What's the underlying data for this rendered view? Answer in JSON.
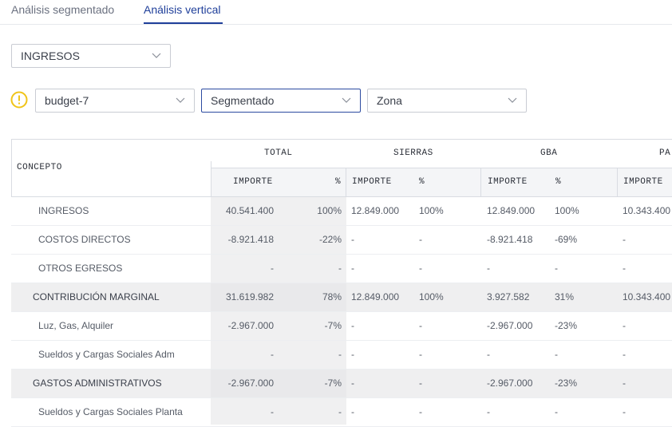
{
  "tabs": [
    {
      "label": "Análisis segmentado",
      "active": false
    },
    {
      "label": "Análisis vertical",
      "active": true
    }
  ],
  "filters": {
    "concept": "INGRESOS",
    "budget": "budget-7",
    "mode": "Segmentado",
    "zone": "Zona"
  },
  "table": {
    "concept_header": "CONCEPTO",
    "groups": [
      "TOTAL",
      "SIERRAS",
      "GBA",
      "PA"
    ],
    "importe": "IMPORTE",
    "pct": "%",
    "rows": [
      {
        "label": "INGRESOS",
        "total": "40.541.400",
        "total_pct": "100%",
        "s": "12.849.000",
        "s_pct": "100%",
        "g": "12.849.000",
        "g_pct": "100%",
        "p": "10.343.400",
        "indent": true,
        "shade": false
      },
      {
        "label": "COSTOS DIRECTOS",
        "total": "-8.921.418",
        "total_pct": "-22%",
        "s": "-",
        "s_pct": "-",
        "g": "-8.921.418",
        "g_pct": "-69%",
        "p": "-",
        "indent": true,
        "shade": false
      },
      {
        "label": "OTROS EGRESOS",
        "total": "-",
        "total_pct": "-",
        "s": "-",
        "s_pct": "-",
        "g": "-",
        "g_pct": "-",
        "p": "-",
        "indent": true,
        "shade": false
      },
      {
        "label": "CONTRIBUCIÓN MARGINAL",
        "total": "31.619.982",
        "total_pct": "78%",
        "s": "12.849.000",
        "s_pct": "100%",
        "g": "3.927.582",
        "g_pct": "31%",
        "p": "10.343.400",
        "indent": false,
        "shade": true
      },
      {
        "label": "Luz, Gas, Alquiler",
        "total": "-2.967.000",
        "total_pct": "-7%",
        "s": "-",
        "s_pct": "-",
        "g": "-2.967.000",
        "g_pct": "-23%",
        "p": "-",
        "indent": true,
        "shade": false
      },
      {
        "label": "Sueldos y Cargas Sociales Adm",
        "total": "-",
        "total_pct": "-",
        "s": "-",
        "s_pct": "-",
        "g": "-",
        "g_pct": "-",
        "p": "-",
        "indent": true,
        "shade": false
      },
      {
        "label": "GASTOS ADMINISTRATIVOS",
        "total": "-2.967.000",
        "total_pct": "-7%",
        "s": "-",
        "s_pct": "-",
        "g": "-2.967.000",
        "g_pct": "-23%",
        "p": "-",
        "indent": false,
        "shade": true
      },
      {
        "label": "Sueldos y Cargas Sociales Planta",
        "total": "-",
        "total_pct": "-",
        "s": "-",
        "s_pct": "-",
        "g": "-",
        "g_pct": "-",
        "p": "-",
        "indent": true,
        "shade": false
      }
    ]
  },
  "icons": {
    "warning": "warning-circle-icon",
    "chevron": "chevron-down-icon"
  },
  "colors": {
    "accent": "#1f3f9a",
    "warning": "#f0c419"
  }
}
